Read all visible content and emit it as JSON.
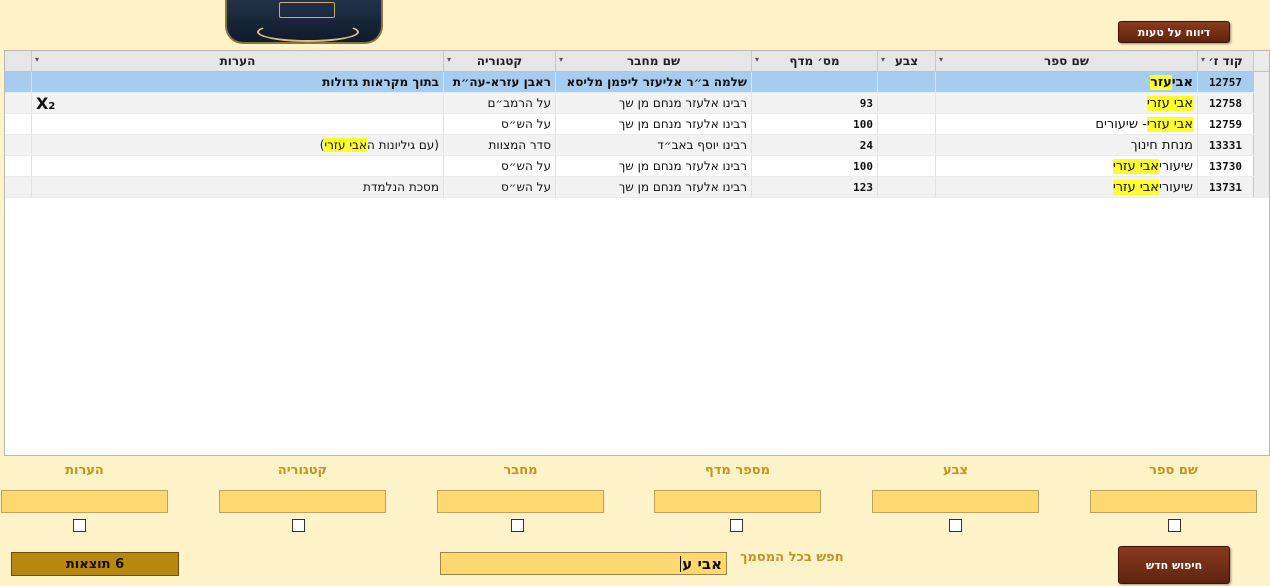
{
  "toolbar": {
    "report_label": "דיווח על טעות",
    "new_search_label": "חיפוש חדש"
  },
  "table": {
    "columns": [
      {
        "key": "code",
        "label": "קוד ז׳"
      },
      {
        "key": "book",
        "label": "שם ספר"
      },
      {
        "key": "color",
        "label": "צבע"
      },
      {
        "key": "shelf",
        "label": "מס׳ מדף"
      },
      {
        "key": "author",
        "label": "שם מחבר"
      },
      {
        "key": "category",
        "label": "קטגוריה"
      },
      {
        "key": "notes",
        "label": "הערות"
      }
    ],
    "rows": [
      {
        "code": "12757",
        "book_plain": "אבי ",
        "book_hl": "עזר",
        "book_after": "",
        "color": "",
        "shelf": "",
        "author": "שלמה ב״ר אליעזר ליפמן מליסא",
        "category": "ראבן עזרא-עה״ת",
        "notes": "בתוך מקראות גדולות"
      },
      {
        "code": "12758",
        "book_plain": "",
        "book_hl": "אבי עזרי",
        "book_after": "",
        "color": "",
        "shelf": "93",
        "author": "רבינו אלעזר מנחם מן שך",
        "category": "על הרמב״ם",
        "notes": "",
        "notes_badge": "X",
        "notes_badge_sub": "2"
      },
      {
        "code": "12759",
        "book_plain": "",
        "book_hl": "אבי עזרי",
        "book_after": " - שיעורים",
        "color": "",
        "shelf": "100",
        "author": "רבינו אלעזר מנחם מן שך",
        "category": "על הש״ס",
        "notes": ""
      },
      {
        "code": "13331",
        "book_plain": "מנחת חינוך",
        "book_hl": "",
        "book_after": "",
        "color": "",
        "shelf": "24",
        "author": "רבינו יוסף באב״ד",
        "category": "סדר המצוות",
        "notes_pre": "(עם גיליונות ה",
        "notes_hl": "אבי עזרי",
        "notes_post": ")"
      },
      {
        "code": "13730",
        "book_plain": "שיעורי ",
        "book_hl": "אבי עזרי",
        "book_after": "",
        "color": "",
        "shelf": "100",
        "author": "רבינו אלעזר מנחם מן שך",
        "category": "על הש״ס",
        "notes": ""
      },
      {
        "code": "13731",
        "book_plain": "שיעורי ",
        "book_hl": "אבי עזרי",
        "book_after": "",
        "color": "",
        "shelf": "123",
        "author": "רבינו אלעזר מנחם מן שך",
        "category": "על הש״ס",
        "notes": "מסכת הנלמדת"
      }
    ]
  },
  "filters": {
    "book_label": "שם ספר",
    "color_label": "צבע",
    "shelf_label": "מספר מדף",
    "author_label": "מחבר",
    "category_label": "קטגוריה",
    "notes_label": "הערות"
  },
  "search": {
    "label": "חפש בכל המסמך",
    "value": "אבי ע"
  },
  "results": {
    "label": "6 תוצאות"
  },
  "colors": {
    "background": "#fdf2c8",
    "field": "#ffd970",
    "label": "#c49320",
    "button": "#6d2c14",
    "highlight": "#ffff2e",
    "selected_row": "#a6cdf0"
  }
}
